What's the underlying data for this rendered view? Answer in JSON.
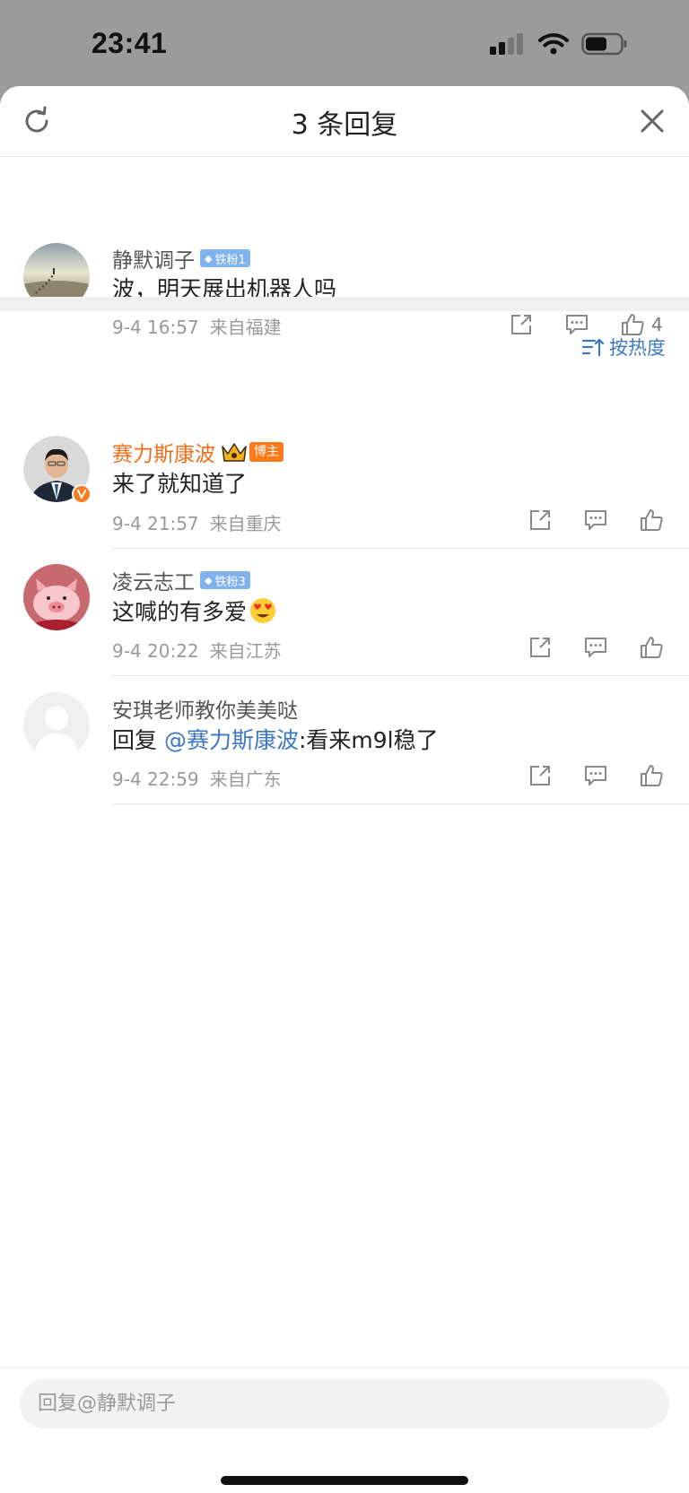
{
  "status_bar": {
    "time": "23:41"
  },
  "header": {
    "title": "3 条回复"
  },
  "root_comment": {
    "user": "静默调子",
    "badge": "铁粉1",
    "text": "波，明天展出机器人吗",
    "date": "9-4 16:57",
    "location": "来自福建",
    "likes": "4"
  },
  "sort_label": "按热度",
  "replies": [
    {
      "user": "赛力斯康波",
      "badge": "博主",
      "text": "来了就知道了",
      "date": "9-4 21:57",
      "location": "来自重庆"
    },
    {
      "user": "凌云志工",
      "badge": "铁粉3",
      "text": "这喊的有多爱",
      "emoji": "😍",
      "date": "9-4 20:22",
      "location": "来自江苏"
    },
    {
      "user": "安琪老师教你美美哒",
      "prefix": "回复 ",
      "mention": "@赛力斯康波",
      "text": ":看来m9l稳了",
      "date": "9-4 22:59",
      "location": "来自广东"
    }
  ],
  "reply_input": {
    "placeholder": "回复@静默调子"
  },
  "colors": {
    "mention": "#3b77c2",
    "blogger_name": "#f26d1a",
    "fan_badge": "#7fb2ef",
    "blogger_badge": "#ff7a1a"
  }
}
